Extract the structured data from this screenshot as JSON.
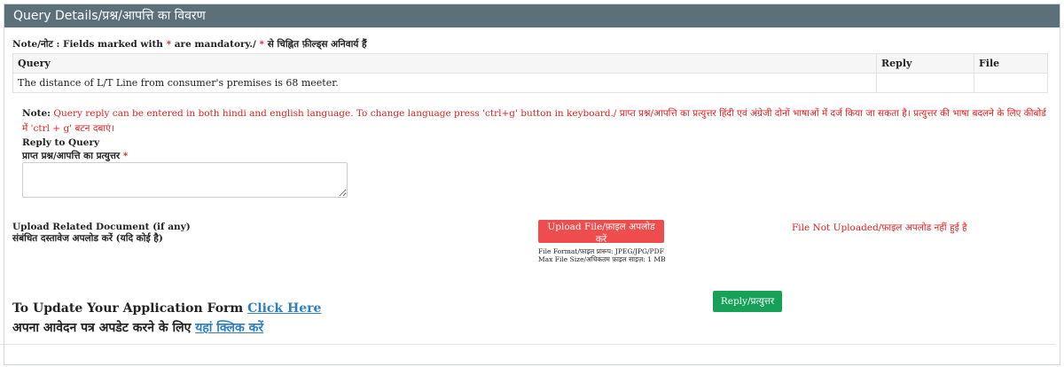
{
  "header": {
    "title": "Query Details/प्रश्न/आपत्ति का विवरण"
  },
  "mandatory_note": {
    "prefix": "Note/नोट : Fields marked with ",
    "star": "*",
    "middle": " are mandatory./ ",
    "star2": "*",
    "suffix": " से चिह्नित फ़ील्ड्स अनिवार्य हैं"
  },
  "query_table": {
    "headers": [
      "Query",
      "Reply",
      "File"
    ],
    "rows": [
      {
        "query": "The distance of L/T Line from consumer's premises is 68 meeter.",
        "reply": "",
        "file": ""
      }
    ]
  },
  "language_note": {
    "label": "Note:",
    "text": " Query reply can be entered in both hindi and english language. To change language press 'ctrl+g' button in keyboard./ प्राप्त प्रश्न/आपत्ति का प्रत्युत्तर हिंदी एवं अंग्रेजी दोनों भाषाओं में दर्ज किया जा सकता है। प्रत्युत्तर की भाषा बदलने के लिए कीबोर्ड में 'ctrl + g' बटन दबाएं।"
  },
  "reply": {
    "label_en": "Reply to Query",
    "label_hi": "प्राप्त प्रश्न/आपत्ति का प्रत्युत्तर ",
    "required_mark": "*",
    "value": "",
    "placeholder": ""
  },
  "upload": {
    "label_en": "Upload Related Document (if any)",
    "label_hi": "संबंधित दस्तावेज अपलोड करें (यदि कोई है)",
    "button_label": "Upload File/फ़ाइल अपलोड करें",
    "format_line": "File Format/फ़ाइल प्रारूप: JPEG/JPG/PDF",
    "size_line": "Max File Size/अधिकतम फ़ाइल साइज़: 1 MB",
    "status": "File Not Uploaded/फ़ाइल अपलोड नहीं हुई है"
  },
  "update_form": {
    "en_text": "To Update Your Application Form ",
    "en_link": "Click Here",
    "hi_text": "अपना आवेदन पत्र अपडेट करने के लिए ",
    "hi_link": "यहां क्लिक करें"
  },
  "actions": {
    "reply_button": "Reply/प्रत्युत्तर"
  },
  "colors": {
    "header_bg": "#5b7078",
    "required": "#e02020",
    "upload_button": "#ef4d4d",
    "reply_button": "#17a058",
    "link": "#2f7fc0"
  }
}
